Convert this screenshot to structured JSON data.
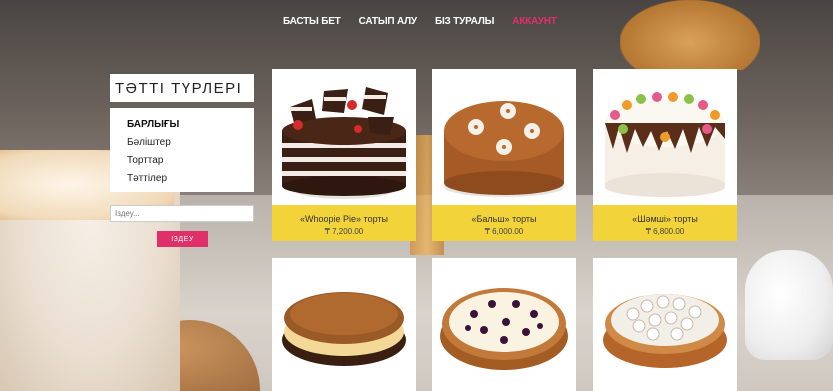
{
  "nav": {
    "items": [
      {
        "label": "БАСТЫ БЕТ"
      },
      {
        "label": "САТЫП АЛУ"
      },
      {
        "label": "БІЗ ТУРАЛЫ"
      },
      {
        "label": "АККАУНТ"
      }
    ],
    "active_color": "#e0306a"
  },
  "sidebar": {
    "title": "ТӘТТІ ТҮРЛЕРІ",
    "categories": [
      {
        "label": "БАРЛЫҒЫ"
      },
      {
        "label": "Бәліштер"
      },
      {
        "label": "Торттар"
      },
      {
        "label": "Тәттілер"
      }
    ]
  },
  "search": {
    "placeholder": "Іздеу...",
    "button_label": "ІЗДЕУ"
  },
  "products": [
    {
      "name": "«Whoopie Pie» торты",
      "price": "₸ 7,200.00"
    },
    {
      "name": "«Бальш» торты",
      "price": "₸ 6,000.00"
    },
    {
      "name": "«Шәмшi» торты",
      "price": "₸ 6,800.00"
    }
  ],
  "colors": {
    "accent": "#e0306a",
    "caption_bg": "#f2d33a"
  }
}
